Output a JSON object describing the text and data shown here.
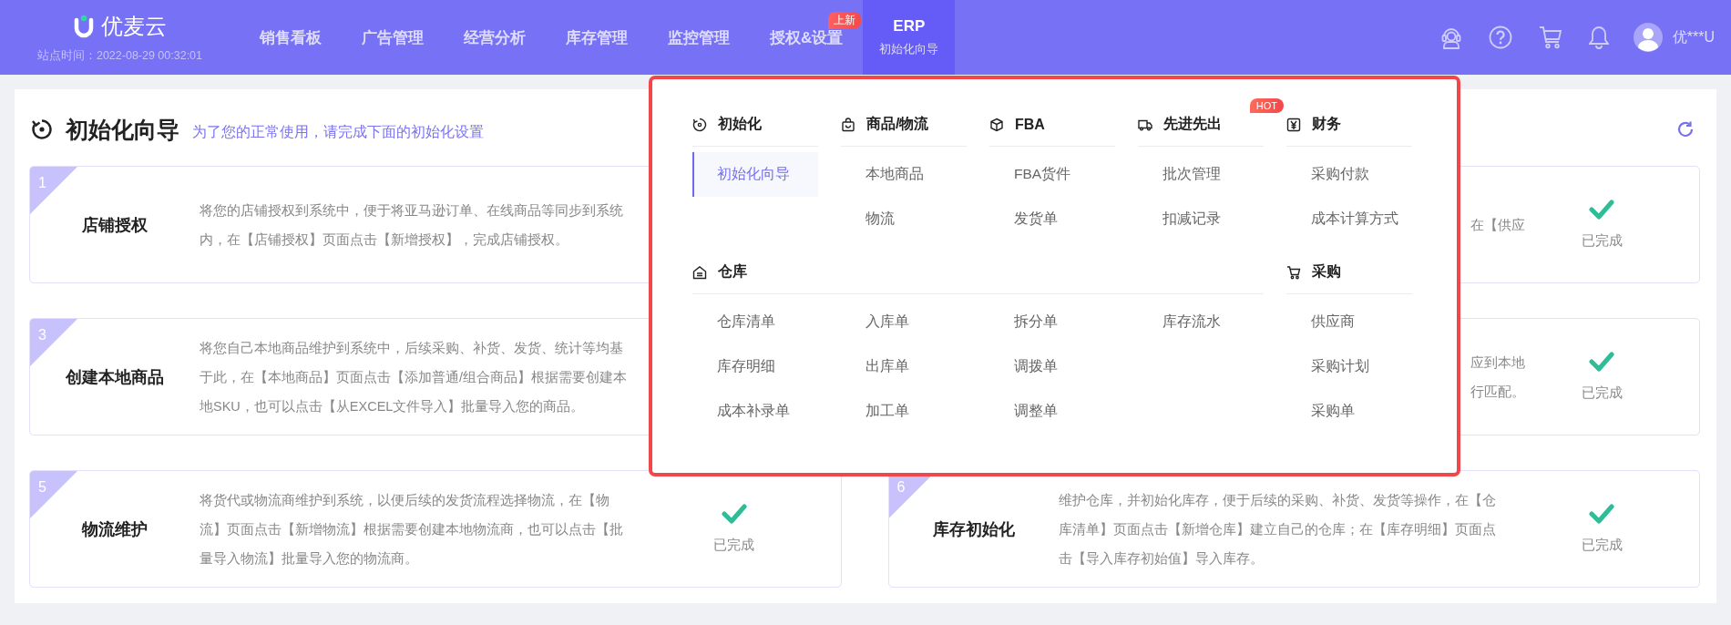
{
  "header": {
    "logo": "优麦云",
    "site_time": "站点时间：2022-08-29 00:32:01",
    "nav": [
      {
        "label": "销售看板",
        "selected": false
      },
      {
        "label": "广告管理",
        "selected": false
      },
      {
        "label": "经营分析",
        "selected": false
      },
      {
        "label": "库存管理",
        "selected": false
      },
      {
        "label": "监控管理",
        "selected": false
      },
      {
        "label": "授权&设置",
        "selected": false,
        "badge": "上新"
      },
      {
        "label": "ERP",
        "selected": true,
        "sublabel": "初始化向导"
      }
    ],
    "user": "优***U"
  },
  "page": {
    "title": "初始化向导",
    "subtitle": "为了您的正常使用，请完成下面的初始化设置",
    "cards": [
      {
        "number": "1",
        "title": "店铺授权",
        "description": "将您的店铺授权到系统中，便于将亚马逊订单、在线商品等同步到系统内，在【店铺授权】页面点击【新增授权】，完成店铺授权。"
      },
      {
        "description_lines": [
          "在【供应"
        ],
        "status": {
          "done": true,
          "label": "已完成"
        }
      },
      {
        "number": "3",
        "title": "创建本地商品",
        "description": "将您自己本地商品维护到系统中，后续采购、补货、发货、统计等均基于此，在【本地商品】页面点击【添加普通/组合商品】根据需要创建本地SKU，也可以点击【从EXCEL文件导入】批量导入您的商品。"
      },
      {
        "description_lines": [
          "应到本地",
          "行匹配。"
        ],
        "status": {
          "done": true,
          "label": "已完成"
        }
      },
      {
        "number": "5",
        "title": "物流维护",
        "description": "将货代或物流商维护到系统，以便后续的发货流程选择物流，在【物流】页面点击【新增物流】根据需要创建本地物流商，也可以点击【批量导入物流】批量导入您的物流商。",
        "status": {
          "done": true,
          "label": "已完成"
        }
      },
      {
        "number": "6",
        "title": "库存初始化",
        "description": "维护仓库，并初始化库存，便于后续的采购、补货、发货等操作，在【仓库清单】页面点击【新增仓库】建立自己的仓库；在【库存明细】页面点击【导入库存初始值】导入库存。",
        "status": {
          "done": true,
          "label": "已完成"
        }
      }
    ]
  },
  "menu": {
    "groups": [
      {
        "title": "初始化",
        "item_columns": [
          [
            {
              "label": "初始化向导",
              "selected": true
            }
          ]
        ]
      },
      {
        "title": "商品/物流",
        "item_columns": [
          [
            {
              "label": "本地商品",
              "selected": false
            },
            {
              "label": "物流",
              "selected": false
            }
          ]
        ]
      },
      {
        "title": "FBA",
        "item_columns": [
          [
            {
              "label": "FBA货件",
              "selected": false
            },
            {
              "label": "发货单",
              "selected": false
            }
          ]
        ]
      },
      {
        "title": "先进先出",
        "badge": "HOT",
        "item_columns": [
          [
            {
              "label": "批次管理",
              "selected": false
            },
            {
              "label": "扣减记录",
              "selected": false
            }
          ]
        ]
      },
      {
        "title": "财务",
        "item_columns": [
          [
            {
              "label": "采购付款",
              "selected": false
            },
            {
              "label": "成本计算方式",
              "selected": false
            }
          ]
        ]
      },
      {
        "title": "仓库",
        "item_columns": [
          [
            {
              "label": "仓库清单",
              "selected": false
            },
            {
              "label": "库存明细",
              "selected": false
            },
            {
              "label": "成本补录单",
              "selected": false
            }
          ],
          [
            {
              "label": "入库单",
              "selected": false
            },
            {
              "label": "出库单",
              "selected": false
            },
            {
              "label": "加工单",
              "selected": false
            }
          ],
          [
            {
              "label": "拆分单",
              "selected": false
            },
            {
              "label": "调拨单",
              "selected": false
            },
            {
              "label": "调整单",
              "selected": false
            }
          ],
          [
            {
              "label": "库存流水",
              "selected": false
            }
          ]
        ]
      },
      {
        "title": "采购",
        "item_columns": [
          [
            {
              "label": "供应商",
              "selected": false
            },
            {
              "label": "采购计划",
              "selected": false
            },
            {
              "label": "采购单",
              "selected": false
            }
          ]
        ]
      }
    ]
  }
}
